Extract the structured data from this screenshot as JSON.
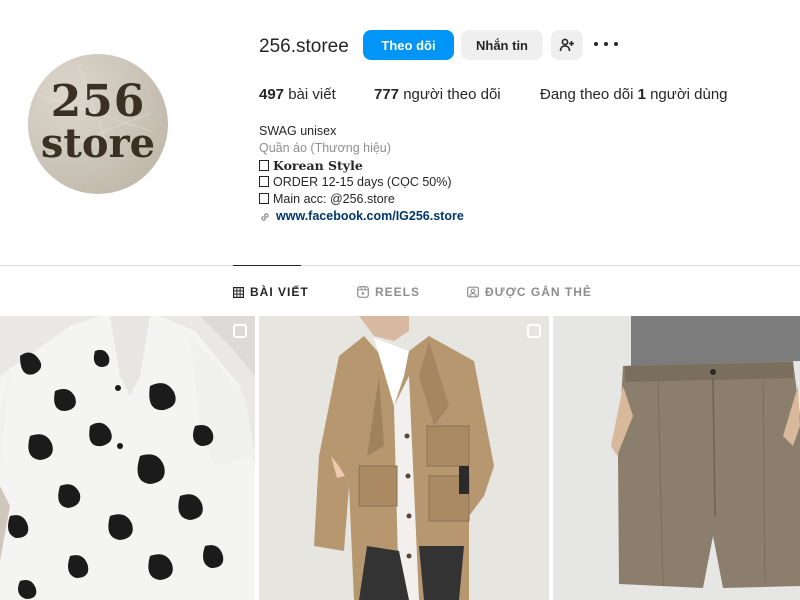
{
  "profile": {
    "username": "256.storee",
    "avatar": {
      "line1": "256",
      "line2": "store"
    },
    "buttons": {
      "follow": "Theo dõi",
      "message": "Nhắn tin"
    },
    "stats": {
      "posts_count": "497",
      "posts_label": "bài viết",
      "followers_count": "777",
      "followers_label": "người theo dõi",
      "following_prefix": "Đang theo dõi",
      "following_count": "1",
      "following_label": "người dùng"
    },
    "bio": {
      "name": "SWAG unisex",
      "category": "Quần áo (Thương hiệu)",
      "line1": "Korean Style",
      "line2": "ORDER 12-15 days (CỌC 50%)",
      "line3": "Main acc: @256.store",
      "link": "www.facebook.com/IG256.store"
    }
  },
  "tabs": [
    {
      "label": "BÀI VIẾT",
      "icon": "grid-icon",
      "active": true
    },
    {
      "label": "REELS",
      "icon": "reels-icon",
      "active": false
    },
    {
      "label": "ĐƯỢC GẮN THẺ",
      "icon": "tagged-icon",
      "active": false
    }
  ],
  "colors": {
    "accent": "#0095f6",
    "link": "#00376b",
    "muted": "#8e8e8e"
  },
  "posts": [
    {
      "desc": "floral print shirt",
      "multi": true
    },
    {
      "desc": "khaki jacket",
      "multi": true
    },
    {
      "desc": "taupe shorts",
      "multi": false
    }
  ]
}
